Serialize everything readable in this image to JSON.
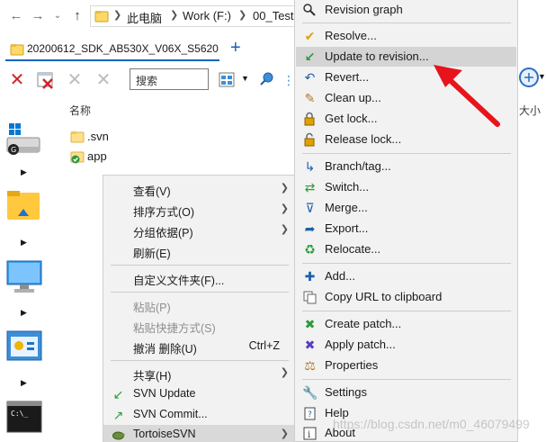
{
  "address": {
    "crumbs": [
      "此电脑",
      "Work (F:)",
      "00_Test"
    ]
  },
  "tab": {
    "title": "20200612_SDK_AB530X_V06X_S5620",
    "new_tab": "+"
  },
  "toolbar": {
    "search_placeholder": "搜索"
  },
  "list": {
    "column_name": "名称",
    "column_size": "大小",
    "files": [
      ".svn",
      "app"
    ]
  },
  "explorer_menu": {
    "view": "查看(V)",
    "sort": "排序方式(O)",
    "group": "分组依据(P)",
    "refresh": "刷新(E)",
    "customize": "自定义文件夹(F)...",
    "paste": "粘贴(P)",
    "paste_shortcut": "粘贴快捷方式(S)",
    "undo_delete": "撤消 删除(U)",
    "undo_shortcut": "Ctrl+Z",
    "share": "共享(H)",
    "svn_update": "SVN Update",
    "svn_commit": "SVN Commit...",
    "tortoise": "TortoiseSVN"
  },
  "svn_menu": {
    "items": [
      "Revision graph",
      "Resolve...",
      "Update to revision...",
      "Revert...",
      "Clean up...",
      "Get lock...",
      "Release lock...",
      "Branch/tag...",
      "Switch...",
      "Merge...",
      "Export...",
      "Relocate...",
      "Add...",
      "Copy URL to clipboard",
      "Create patch...",
      "Apply patch...",
      "Properties",
      "Settings",
      "Help",
      "About"
    ]
  },
  "watermark": "https://blog.csdn.net/m0_46079499",
  "colors": {
    "accent": "#0067c0",
    "arrow": "#e8141c",
    "highlight": "#d4d4d4",
    "menu_bg": "#f2f2f2"
  }
}
